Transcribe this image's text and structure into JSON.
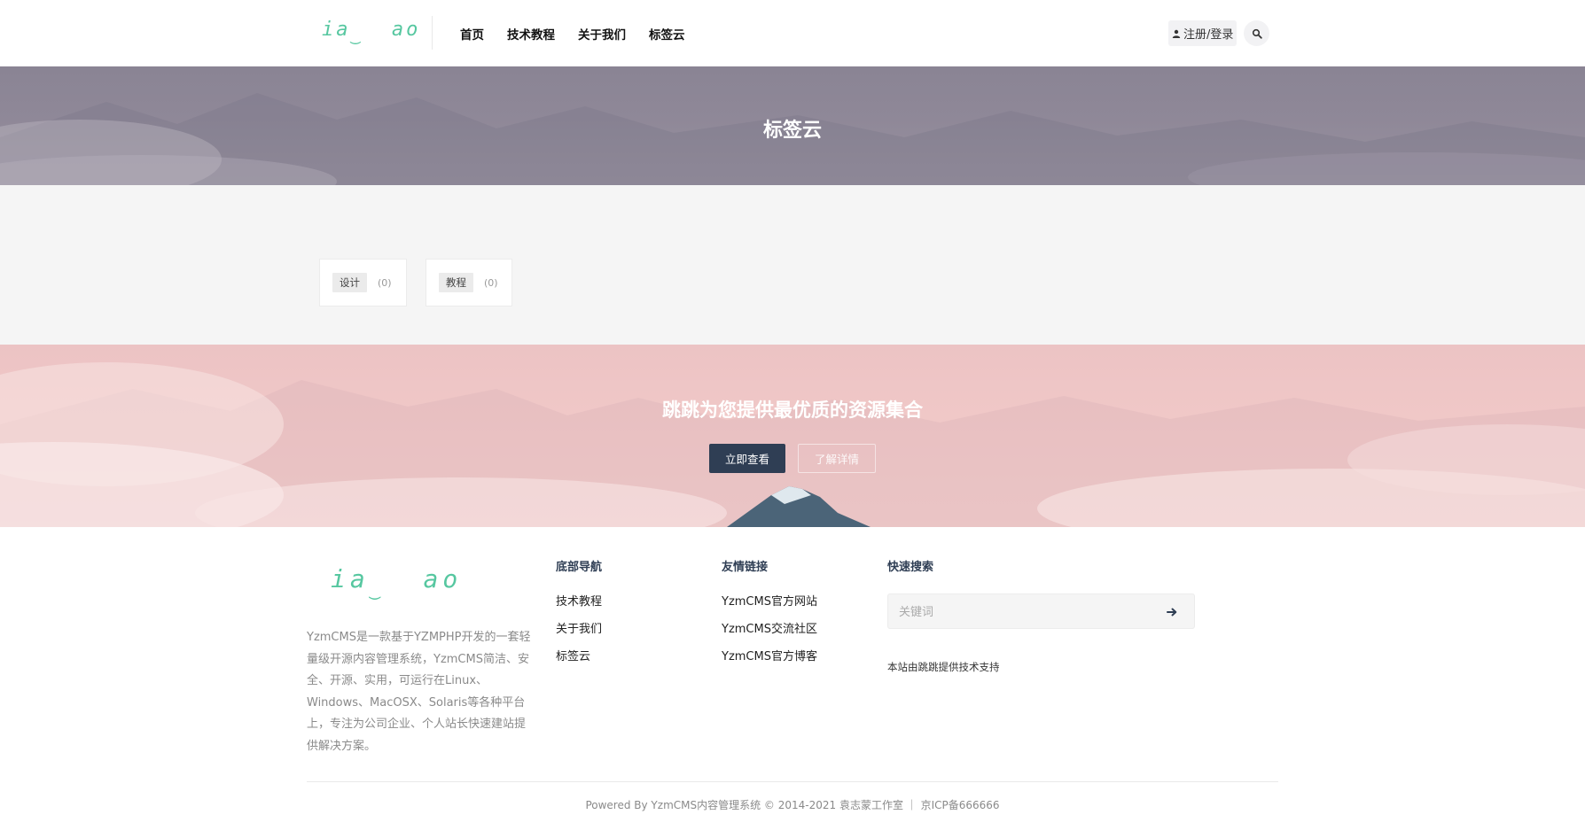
{
  "header": {
    "logo_text": "ia",
    "logo_text2": "ao",
    "nav": [
      "首页",
      "技术教程",
      "关于我们",
      "标签云"
    ],
    "login_label": "注册/登录"
  },
  "banner": {
    "title": "标签云"
  },
  "tags": [
    {
      "name": "设计",
      "count": "(0)"
    },
    {
      "name": "教程",
      "count": "(0)"
    }
  ],
  "promo": {
    "title": "跳跳为您提供最优质的资源集合",
    "primary_button": "立即查看",
    "secondary_button": "了解详情"
  },
  "footer": {
    "logo_text": "ia",
    "logo_text2": "ao",
    "description": "YzmCMS是一款基于YZMPHP开发的一套轻量级开源内容管理系统，YzmCMS简洁、安全、开源、实用，可运行在Linux、Windows、MacOSX、Solaris等各种平台上，专注为公司企业、个人站长快速建站提供解决方案。",
    "nav_title": "底部导航",
    "nav_links": [
      "技术教程",
      "关于我们",
      "标签云"
    ],
    "friend_title": "友情链接",
    "friend_links": [
      "YzmCMS官方网站",
      "YzmCMS交流社区",
      "YzmCMS官方博客"
    ],
    "search_title": "快速搜索",
    "search_placeholder": "关键词",
    "support_text": "本站由跳跳提供技术支持",
    "copyright": "Powered By YzmCMS内容管理系统 © 2014-2021 袁志蒙工作室 ｜ 京ICP备666666"
  },
  "colors": {
    "accent": "#56c7a0",
    "primary": "#2f3e54"
  }
}
